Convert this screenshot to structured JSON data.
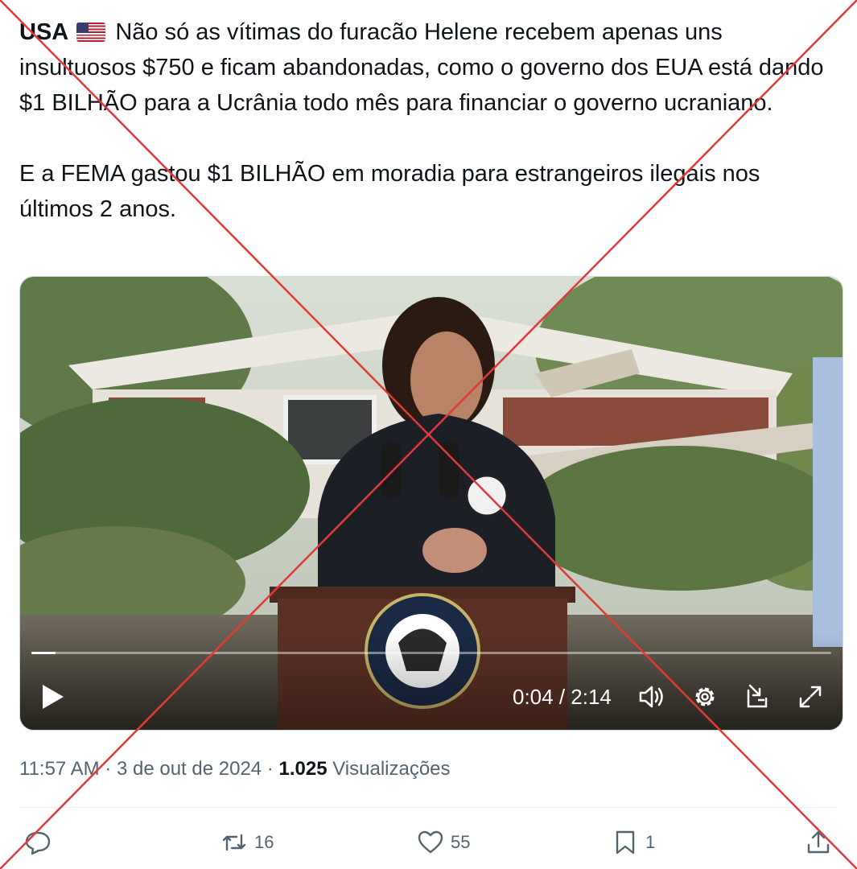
{
  "tweet": {
    "author_tag": "USA",
    "flag_icon": "us-flag-icon",
    "line1": "Não só as vítimas do furacão Helene recebem apenas uns insultuosos $750 e ficam abandonadas, como o governo dos EUA está dando $1 BILHÃO para a Ucrânia todo mês para financiar o governo ucraniano.",
    "line2": "E a FEMA gastou $1 BILHÃO em moradia para estrangeiros ilegais nos últimos 2 anos."
  },
  "video": {
    "progress": 0.03,
    "current_time": "0:04",
    "duration": "2:14",
    "time_label": "0:04 / 2:14",
    "icons": [
      "play-icon",
      "volume-icon",
      "settings-gear-icon",
      "picture-in-picture-icon",
      "fullscreen-icon"
    ]
  },
  "meta": {
    "time": "11:57 AM",
    "date": "3 de out de 2024",
    "views_count": "1.025",
    "views_label": "Visualizações"
  },
  "actions": {
    "reply_count": "",
    "retweet_count": "16",
    "like_count": "55",
    "bookmark_count": "1"
  },
  "colors": {
    "overlay_x": "#e03a3a",
    "secondary_text": "#536471",
    "primary_text": "#0f1419"
  }
}
